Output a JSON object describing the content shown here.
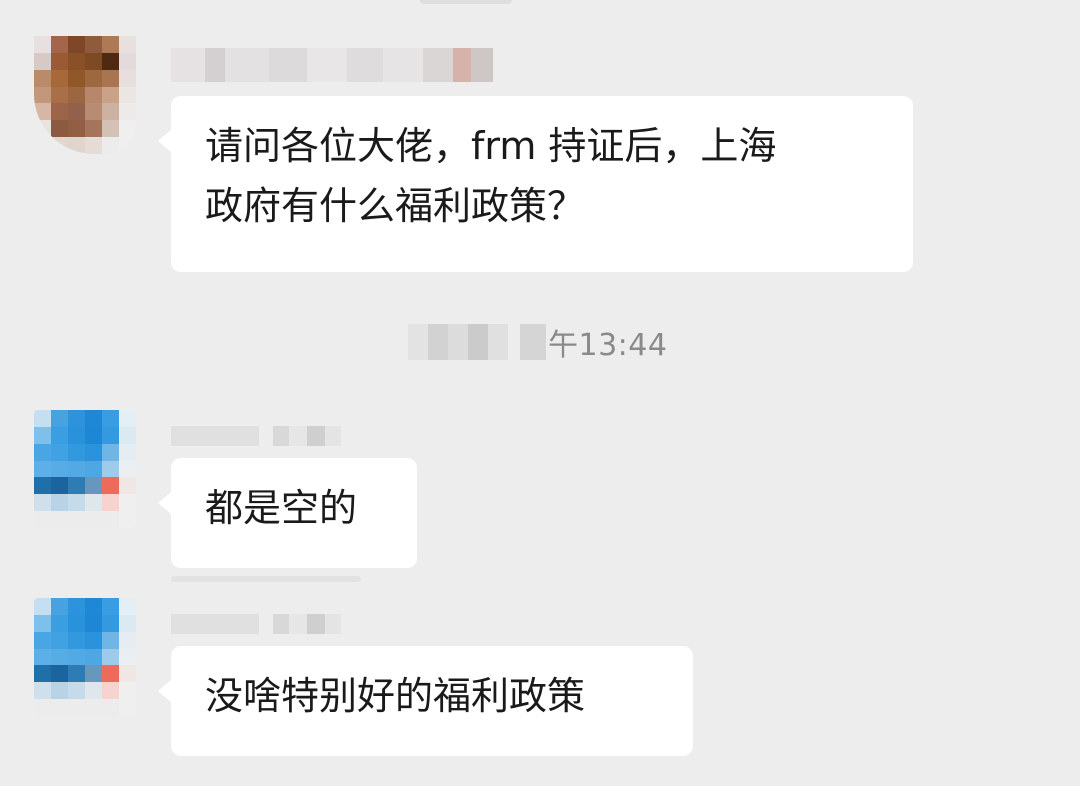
{
  "chat": {
    "messages": [
      {
        "text_line1": "请问各位大佬，frm 持证后，上海",
        "text_line2": "政府有什么福利政策？",
        "avatar_colors": [
          "#e7dfe0",
          "#a4654b",
          "#7e4728",
          "#8e5b3d",
          "#ad7a55",
          "#e8e0df",
          "#d9c9c4",
          "#9a5a33",
          "#8a5128",
          "#7e4a23",
          "#4e2a12",
          "#e2dadb",
          "#b98b6a",
          "#a86938",
          "#925728",
          "#9d6840",
          "#a97550",
          "#e6dfde",
          "#c2977a",
          "#a86f48",
          "#9b6640",
          "#b8866a",
          "#c9a288",
          "#ebe5e4",
          "#d5b7a4",
          "#9c6448",
          "#93614b",
          "#b88c73",
          "#cdb2a2",
          "#eeeaea",
          "#e9e2df",
          "#8c5a40",
          "#925f44",
          "#a4755c",
          "#d3c1b6",
          "#efefef",
          "#ececec",
          "#e2d6d0",
          "#e1d4cd",
          "#e6dcd7",
          "#ececec",
          "#efefef"
        ]
      },
      {
        "text": "都是空的",
        "avatar_colors": [
          "#c5dff2",
          "#47a3e0",
          "#2d93dc",
          "#1e88d7",
          "#3a9ce1",
          "#e4eef5",
          "#7ec0ec",
          "#3a9fe2",
          "#2a92db",
          "#1d87d6",
          "#3499df",
          "#dbe9f3",
          "#4aa5e4",
          "#40a1e3",
          "#3399df",
          "#2b93dc",
          "#6fb5e6",
          "#e5edf3",
          "#5cafe7",
          "#57ace6",
          "#52a9e4",
          "#4ea7e2",
          "#9ccbeb",
          "#eceff1",
          "#1f6fa8",
          "#1a64a0",
          "#2d7cb3",
          "#6698be",
          "#ee6b5a",
          "#f0e6e4",
          "#cfe0ec",
          "#b9d3e6",
          "#c6dbe9",
          "#dfe6ec",
          "#f6d3ce",
          "#efefef",
          "#ececec",
          "#ececec",
          "#ececec",
          "#ececec",
          "#ececec",
          "#efefef"
        ]
      },
      {
        "text": "没啥特别好的福利政策",
        "avatar_colors": [
          "#c5dff2",
          "#47a3e0",
          "#2d93dc",
          "#1e88d7",
          "#3a9ce1",
          "#e4eef5",
          "#7ec0ec",
          "#3a9fe2",
          "#2a92db",
          "#1d87d6",
          "#3499df",
          "#dbe9f3",
          "#4aa5e4",
          "#40a1e3",
          "#3399df",
          "#2b93dc",
          "#6fb5e6",
          "#e5edf3",
          "#5cafe7",
          "#57ace6",
          "#52a9e4",
          "#4ea7e2",
          "#9ccbeb",
          "#eceff1",
          "#1f6fa8",
          "#1a64a0",
          "#2d7cb3",
          "#6698be",
          "#ee6b5a",
          "#f0e6e4",
          "#cfe0ec",
          "#b9d3e6",
          "#c6dbe9",
          "#dfe6ec",
          "#f6d3ce",
          "#efefef",
          "#ececec",
          "#ececec",
          "#ececec",
          "#ececec",
          "#ececec",
          "#efefef"
        ]
      }
    ],
    "timestamp": "午13:44",
    "colors": {
      "background": "#ededed",
      "bubble": "#ffffff",
      "text": "#1a1a1a",
      "timestamp": "#8a8a8a"
    }
  }
}
